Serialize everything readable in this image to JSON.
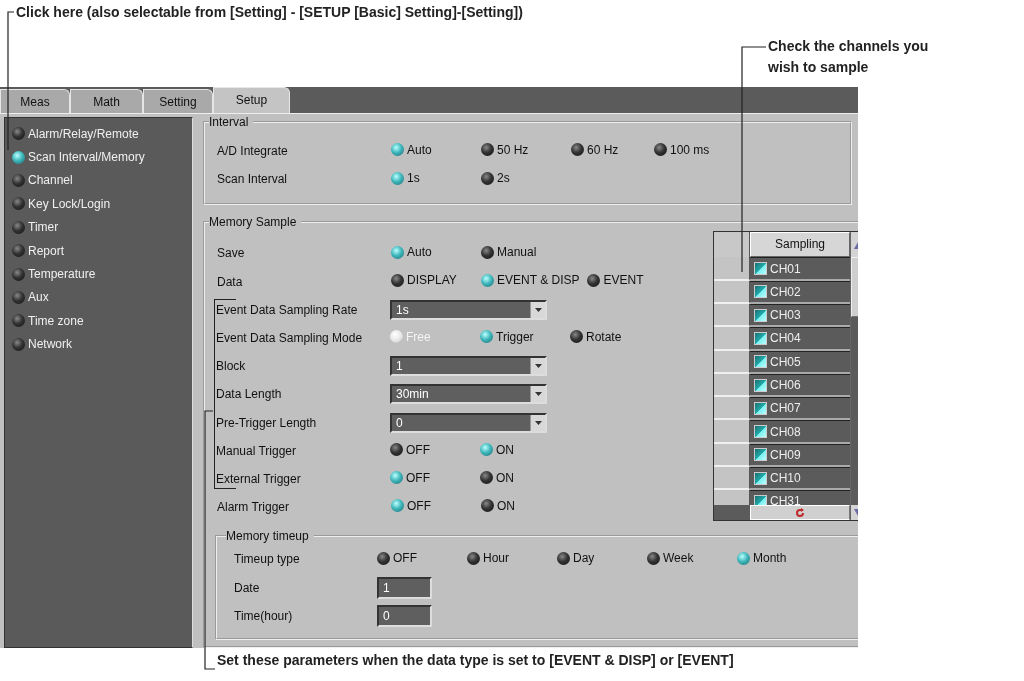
{
  "callout_top": {
    "text": "Click here (also selectable from [Setting] - [SETUP [Basic] Setting]-[Setting])"
  },
  "callout_channels": {
    "text": "Check the channels you wish to sample"
  },
  "callout_bottom": {
    "text": "Set these parameters when the data type is set to [EVENT & DISP] or [EVENT]"
  },
  "tabs": [
    {
      "label": "Meas",
      "selected": false
    },
    {
      "label": "Math",
      "selected": false
    },
    {
      "label": "Setting",
      "selected": false
    },
    {
      "label": "Setup",
      "selected": true
    }
  ],
  "sidebar": {
    "items": [
      {
        "label": "Alarm/Relay/Remote",
        "selected": false
      },
      {
        "label": "Scan Interval/Memory",
        "selected": true
      },
      {
        "label": "Channel",
        "selected": false
      },
      {
        "label": "Key Lock/Login",
        "selected": false
      },
      {
        "label": "Timer",
        "selected": false
      },
      {
        "label": "Report",
        "selected": false
      },
      {
        "label": "Temperature",
        "selected": false
      },
      {
        "label": "Aux",
        "selected": false
      },
      {
        "label": "Time zone",
        "selected": false
      },
      {
        "label": "Network",
        "selected": false
      }
    ]
  },
  "interval": {
    "title": "Interval",
    "rows": [
      {
        "kind": "radio",
        "label": "A/D Integrate",
        "options": [
          {
            "label": "Auto",
            "selected": true,
            "disabled": false
          },
          {
            "label": "50 Hz",
            "selected": false,
            "disabled": false
          },
          {
            "label": "60 Hz",
            "selected": false,
            "disabled": false
          },
          {
            "label": "100 ms",
            "selected": false,
            "disabled": false
          }
        ]
      },
      {
        "kind": "radio",
        "label": "Scan Interval",
        "options": [
          {
            "label": "1s",
            "selected": true,
            "disabled": false
          },
          {
            "label": "2s",
            "selected": false,
            "disabled": false
          }
        ]
      }
    ]
  },
  "memory_sample": {
    "title": "Memory Sample",
    "rows": [
      {
        "kind": "radio",
        "label": "Save",
        "options": [
          {
            "label": "Auto",
            "selected": true,
            "disabled": false
          },
          {
            "label": "Manual",
            "selected": false,
            "disabled": false
          }
        ]
      },
      {
        "kind": "radio",
        "label": "Data",
        "options": [
          {
            "label": "DISPLAY",
            "selected": false,
            "disabled": false
          },
          {
            "label": "EVENT & DISP",
            "selected": true,
            "disabled": false
          },
          {
            "label": "EVENT",
            "selected": false,
            "disabled": false
          }
        ]
      }
    ],
    "event_rows": [
      {
        "kind": "select",
        "label": "Event Data Sampling Rate",
        "value": "1s"
      },
      {
        "kind": "radio",
        "label": "Event Data Sampling Mode",
        "options": [
          {
            "label": "Free",
            "selected": false,
            "disabled": true
          },
          {
            "label": "Trigger",
            "selected": true,
            "disabled": false
          },
          {
            "label": "Rotate",
            "selected": false,
            "disabled": false
          }
        ]
      },
      {
        "kind": "select",
        "label": "Block",
        "value": "1"
      },
      {
        "kind": "select",
        "label": "Data Length",
        "value": "30min"
      },
      {
        "kind": "select",
        "label": "Pre-Trigger Length",
        "value": "0"
      },
      {
        "kind": "radio",
        "label": "Manual Trigger",
        "options": [
          {
            "label": "OFF",
            "selected": false,
            "disabled": false
          },
          {
            "label": "ON",
            "selected": true,
            "disabled": false
          }
        ]
      },
      {
        "kind": "radio",
        "label": "External Trigger",
        "options": [
          {
            "label": "OFF",
            "selected": true,
            "disabled": false
          },
          {
            "label": "ON",
            "selected": false,
            "disabled": false
          }
        ]
      }
    ],
    "trailing_rows": [
      {
        "kind": "radio",
        "label": "Alarm Trigger",
        "options": [
          {
            "label": "OFF",
            "selected": true,
            "disabled": false
          },
          {
            "label": "ON",
            "selected": false,
            "disabled": false
          }
        ]
      }
    ],
    "sampling_table": {
      "header": "Sampling",
      "rows": [
        {
          "label": "CH01",
          "checked": true
        },
        {
          "label": "CH02",
          "checked": true
        },
        {
          "label": "CH03",
          "checked": true
        },
        {
          "label": "CH04",
          "checked": true
        },
        {
          "label": "CH05",
          "checked": true
        },
        {
          "label": "CH06",
          "checked": true
        },
        {
          "label": "CH07",
          "checked": true
        },
        {
          "label": "CH08",
          "checked": true
        },
        {
          "label": "CH09",
          "checked": true
        },
        {
          "label": "CH10",
          "checked": true
        },
        {
          "label": "CH31",
          "checked": true
        }
      ]
    },
    "memory_timeup": {
      "title": "Memory timeup",
      "rows": [
        {
          "kind": "radio",
          "label": "Timeup type",
          "options": [
            {
              "label": "OFF",
              "selected": false,
              "disabled": false
            },
            {
              "label": "Hour",
              "selected": false,
              "disabled": false
            },
            {
              "label": "Day",
              "selected": false,
              "disabled": false
            },
            {
              "label": "Week",
              "selected": false,
              "disabled": false
            },
            {
              "label": "Month",
              "selected": true,
              "disabled": false
            }
          ]
        },
        {
          "kind": "input",
          "label": "Date",
          "value": "1"
        },
        {
          "kind": "input",
          "label": "Time(hour)",
          "value": "0"
        }
      ]
    }
  }
}
